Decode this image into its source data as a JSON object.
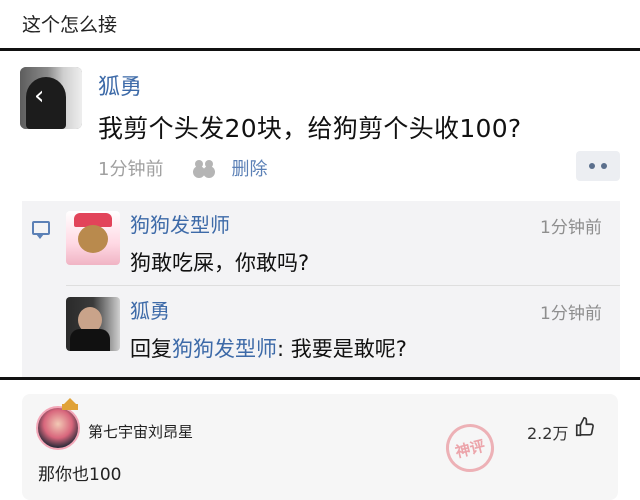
{
  "post": {
    "title": "这个怎么接"
  },
  "screenshot": {
    "main": {
      "name": "狐勇",
      "text": "我剪个头发20块，给狗剪个头收100?",
      "time": "1分钟前",
      "delete_label": "删除"
    },
    "comments": [
      {
        "name": "狗狗发型师",
        "time": "1分钟前",
        "text": "狗敢吃屎，你敢吗?"
      },
      {
        "name": "狐勇",
        "time": "1分钟前",
        "prefix": "回复",
        "mention": "狗狗发型师",
        "text": ": 我要是敢呢?"
      }
    ]
  },
  "reply": {
    "username": "第七宇宙刘昂星",
    "likes": "2.2万",
    "text": "那你也100",
    "stamp": "神评"
  },
  "colors": {
    "link": "#3d6aa8",
    "muted": "#a0a0a0",
    "border": "#111111"
  }
}
